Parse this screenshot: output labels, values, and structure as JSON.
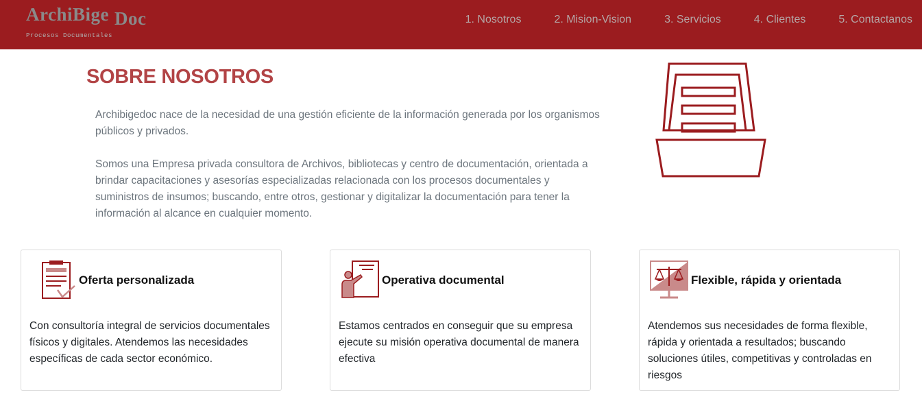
{
  "brand": {
    "name_part1": "ArchiBige",
    "name_part2": "Doc",
    "tagline": "Procesos Documentales"
  },
  "nav": [
    {
      "label": "1. Nosotros"
    },
    {
      "label": "2. Mision-Vision"
    },
    {
      "label": "3. Servicios"
    },
    {
      "label": "4. Clientes"
    },
    {
      "label": "5. Contactanos"
    }
  ],
  "about": {
    "title": "SOBRE NOSOTROS",
    "paragraphs": [
      "Archibigedoc nace de la necesidad de una gestión eficiente de la información generada por los organismos públicos y privados.",
      "Somos una Empresa privada consultora de Archivos, bibliotecas y centro de documentación, orientada a brindar capacitaciones y asesorías especializadas relacionada con los procesos documentales y suministros de insumos; buscando, entre otros, gestionar y digitalizar la documentación para tener la información al alcance en cualquier momento."
    ]
  },
  "features": [
    {
      "title": "Oferta personalizada",
      "text": "Con consultoría integral de servicios documentales físicos y digitales. Atendemos las necesidades específicas de cada sector económico.",
      "icon": "clipboard-icon"
    },
    {
      "title": "Operativa documental",
      "text": "Estamos centrados en conseguir que su empresa ejecute su misión operativa documental de manera efectiva",
      "icon": "presenter-icon"
    },
    {
      "title": "Flexible, rápida y orientada",
      "text": "Atendemos sus necesidades de forma flexible, rápida y orientada a resultados; buscando soluciones útiles, competitivas y controladas en riesgos",
      "icon": "balance-scale-icon"
    }
  ],
  "colors": {
    "navbar": "#9b1c1f",
    "accent": "#b24446",
    "icon": "#9b1c1f",
    "icon_light": "#c98a8a"
  }
}
